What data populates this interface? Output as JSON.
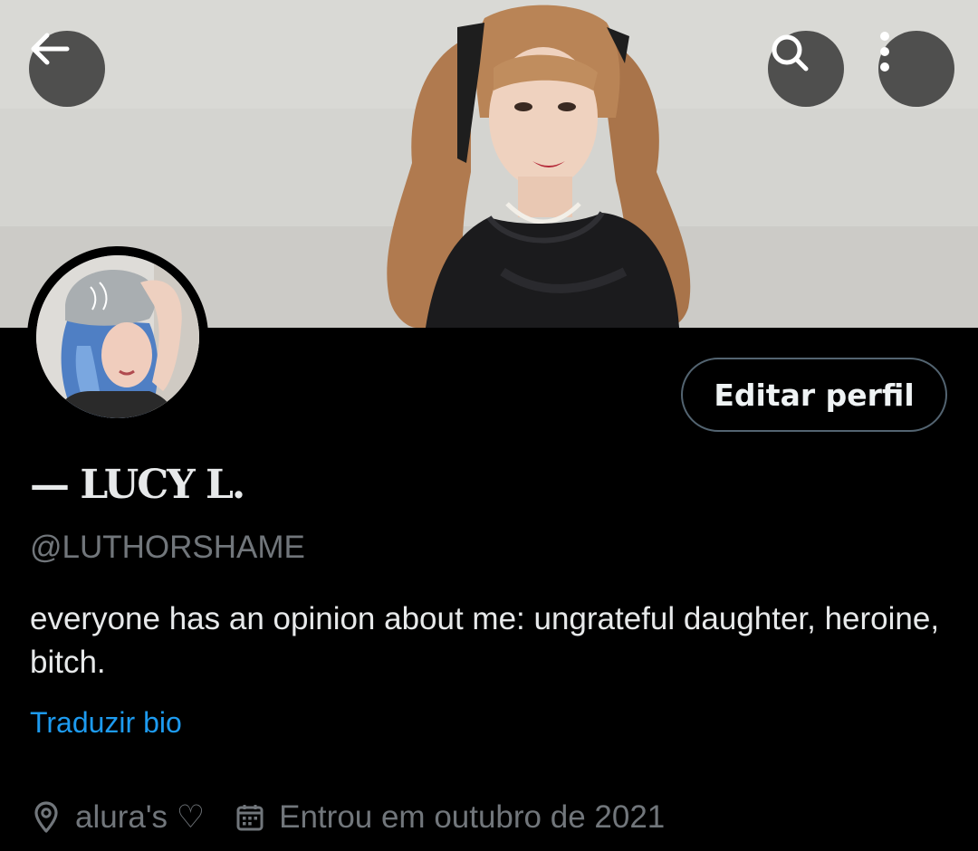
{
  "header": {
    "back_icon": "arrow-left-icon",
    "search_icon": "search-icon",
    "more_icon": "more-vertical-icon"
  },
  "profile": {
    "display_name": "— LUCY L.",
    "handle": "@LUTHORSHAME",
    "bio": "everyone has an opinion about me: ungrateful daughter, heroine, bitch.",
    "translate_label": "Traduzir bio",
    "edit_button_label": "Editar perfil",
    "location": "alura's ♡",
    "joined": "Entrou em outubro de 2021"
  },
  "icons": {
    "location": "location-pin-icon",
    "joined": "calendar-icon"
  },
  "colors": {
    "background": "#000000",
    "text_primary": "#e7e9ea",
    "text_secondary": "#71767b",
    "link": "#1d9bf0",
    "button_border": "#536471"
  }
}
